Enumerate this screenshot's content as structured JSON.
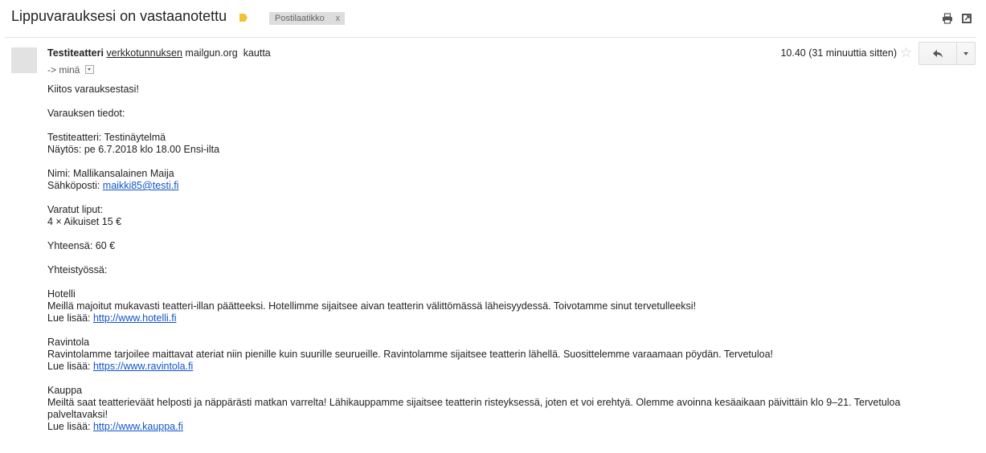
{
  "header": {
    "subject": "Lippuvarauksesi on vastaanotettu",
    "label": "Postilaatikko",
    "label_remove": "x",
    "icons": [
      "print-icon",
      "new-window-icon"
    ]
  },
  "message": {
    "sender_name": "Testiteatteri",
    "via_link": "verkkotunnuksen",
    "via_domain": "mailgun.org",
    "via_word": "kautta",
    "to_text": "-> minä",
    "time": "10.40 (31 minuuttia sitten)"
  },
  "body": {
    "greeting": "Kiitos varauksestasi!",
    "details_title": "Varauksen tiedot:",
    "theatre": "Testiteatteri: Testinäytelmä",
    "show": "Näytös: pe 6.7.2018 klo 18.00 Ensi-ilta",
    "name": "Nimi: Mallikansalainen Maija",
    "email_label": "Sähköposti: ",
    "email": "maikki85@testi.fi",
    "tickets_title": "Varatut liput:",
    "tickets": "4 × Aikuiset 15 €",
    "total": "Yhteensä: 60 €",
    "partners_title": "Yhteistyössä:",
    "read_more_label": "Lue lisää: ",
    "partners": [
      {
        "name": "Hotelli",
        "text": "Meillä majoitut mukavasti teatteri-illan päätteeksi. Hotellimme sijaitsee aivan teatterin välittömässä läheisyydessä. Toivotamme sinut tervetulleeksi!",
        "link": "http://www.hotelli.fi"
      },
      {
        "name": "Ravintola",
        "text": "Ravintolamme tarjoilee maittavat ateriat niin pienille kuin suurille seurueille. Ravintolamme sijaitsee teatterin lähellä. Suosittelemme varaamaan pöydän. Tervetuloa!",
        "link": "https://www.ravintola.fi"
      },
      {
        "name": "Kauppa",
        "text": "Meiltä saat teatterieväät helposti ja näppärästi matkan varrelta! Lähikauppamme sijaitsee teatterin risteyksessä, joten et voi erehtyä. Olemme avoinna kesäaikaan päivittäin klo 9–21. Tervetuloa palveltavaksi!",
        "link": "http://www.kauppa.fi"
      }
    ]
  },
  "colors": {
    "link": "#1155cc",
    "importance": "#f2c234",
    "label_bg": "#dddddd"
  }
}
